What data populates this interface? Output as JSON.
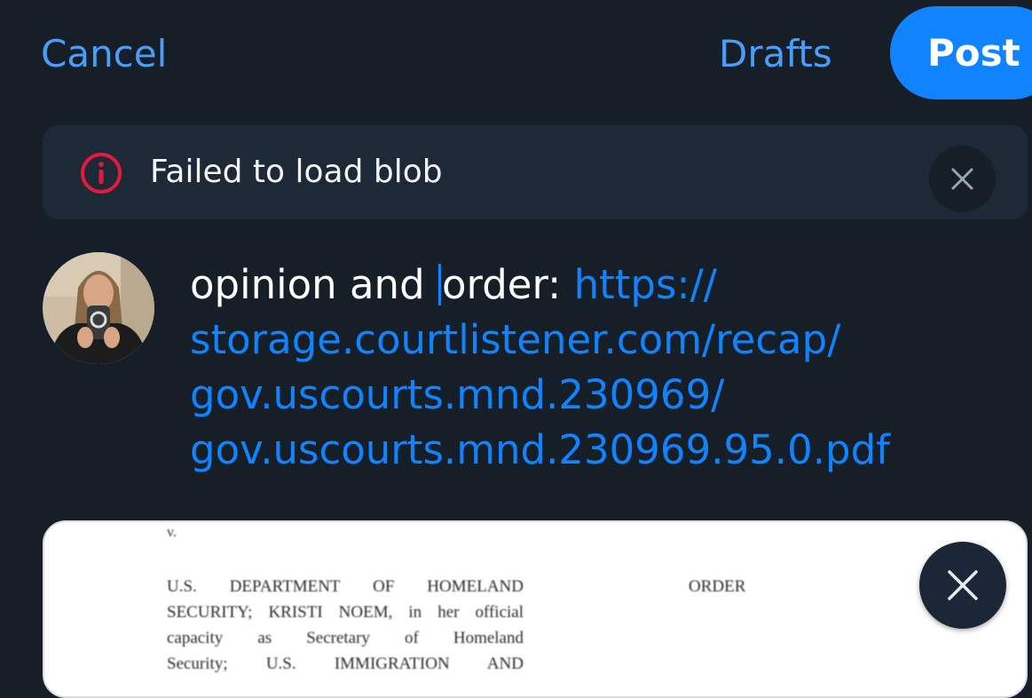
{
  "header": {
    "cancel_label": "Cancel",
    "drafts_label": "Drafts",
    "post_label": "Post"
  },
  "error": {
    "icon": "info-circle-icon",
    "message": "Failed to load blob",
    "dismiss_icon": "close-icon"
  },
  "composer": {
    "text_before_caret": "opinion and ",
    "text_after_caret": "order: ",
    "link_lines": [
      "https://",
      "storage.courtlistener.com/recap/",
      "gov.uscourts.mnd.230969/",
      "gov.uscourts.mnd.230969.95.0.pdf"
    ]
  },
  "attachment": {
    "doc_v": "v.",
    "caption_lines": [
      "U.S. DEPARTMENT OF HOMELAND",
      "SECURITY; KRISTI NOEM, in her official",
      "capacity as Secretary of Homeland",
      "Security; U.S. IMMIGRATION AND"
    ],
    "order_label": "ORDER",
    "remove_icon": "close-icon"
  },
  "colors": {
    "background": "#161e27",
    "accent": "#1083fe",
    "link_text": "#4a9df8",
    "error_red": "#e5193a",
    "banner": "#1e2937"
  }
}
